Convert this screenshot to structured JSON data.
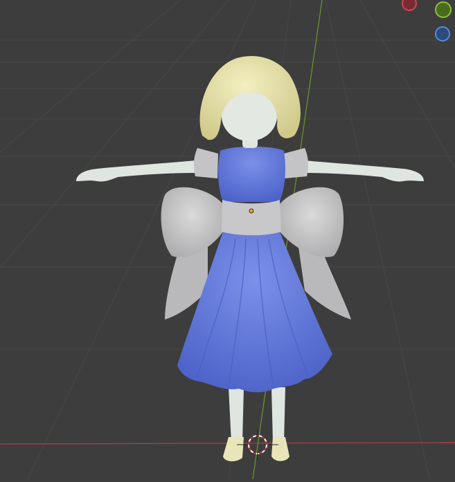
{
  "viewport": {
    "type": "3d-viewport",
    "shading": "solid"
  },
  "navigation_gizmo": {
    "x_axis_color": "#d04757",
    "y_axis_color": "#8bc33a",
    "z_axis_color": "#4d8ee0"
  },
  "scene": {
    "object": "character-model",
    "hair_color": "#e6e2a6",
    "dress_color": "#5f78da",
    "bow_color": "#c9c9cb",
    "skin_color": "#dfe5df"
  },
  "grid": {
    "floor_color": "#3d3d3d",
    "line_color": "#4a4a4a",
    "x_axis_color": "#b83a48",
    "y_axis_color": "#6b9a2a"
  }
}
